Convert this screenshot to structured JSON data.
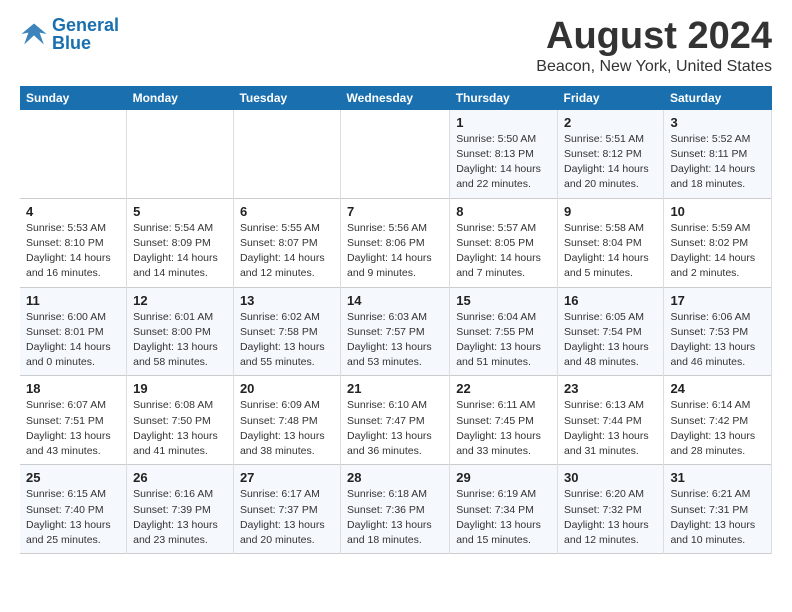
{
  "logo": {
    "text_general": "General",
    "text_blue": "Blue"
  },
  "title": "August 2024",
  "location": "Beacon, New York, United States",
  "days_of_week": [
    "Sunday",
    "Monday",
    "Tuesday",
    "Wednesday",
    "Thursday",
    "Friday",
    "Saturday"
  ],
  "weeks": [
    [
      {
        "num": "",
        "detail": ""
      },
      {
        "num": "",
        "detail": ""
      },
      {
        "num": "",
        "detail": ""
      },
      {
        "num": "",
        "detail": ""
      },
      {
        "num": "1",
        "detail": "Sunrise: 5:50 AM\nSunset: 8:13 PM\nDaylight: 14 hours\nand 22 minutes."
      },
      {
        "num": "2",
        "detail": "Sunrise: 5:51 AM\nSunset: 8:12 PM\nDaylight: 14 hours\nand 20 minutes."
      },
      {
        "num": "3",
        "detail": "Sunrise: 5:52 AM\nSunset: 8:11 PM\nDaylight: 14 hours\nand 18 minutes."
      }
    ],
    [
      {
        "num": "4",
        "detail": "Sunrise: 5:53 AM\nSunset: 8:10 PM\nDaylight: 14 hours\nand 16 minutes."
      },
      {
        "num": "5",
        "detail": "Sunrise: 5:54 AM\nSunset: 8:09 PM\nDaylight: 14 hours\nand 14 minutes."
      },
      {
        "num": "6",
        "detail": "Sunrise: 5:55 AM\nSunset: 8:07 PM\nDaylight: 14 hours\nand 12 minutes."
      },
      {
        "num": "7",
        "detail": "Sunrise: 5:56 AM\nSunset: 8:06 PM\nDaylight: 14 hours\nand 9 minutes."
      },
      {
        "num": "8",
        "detail": "Sunrise: 5:57 AM\nSunset: 8:05 PM\nDaylight: 14 hours\nand 7 minutes."
      },
      {
        "num": "9",
        "detail": "Sunrise: 5:58 AM\nSunset: 8:04 PM\nDaylight: 14 hours\nand 5 minutes."
      },
      {
        "num": "10",
        "detail": "Sunrise: 5:59 AM\nSunset: 8:02 PM\nDaylight: 14 hours\nand 2 minutes."
      }
    ],
    [
      {
        "num": "11",
        "detail": "Sunrise: 6:00 AM\nSunset: 8:01 PM\nDaylight: 14 hours\nand 0 minutes."
      },
      {
        "num": "12",
        "detail": "Sunrise: 6:01 AM\nSunset: 8:00 PM\nDaylight: 13 hours\nand 58 minutes."
      },
      {
        "num": "13",
        "detail": "Sunrise: 6:02 AM\nSunset: 7:58 PM\nDaylight: 13 hours\nand 55 minutes."
      },
      {
        "num": "14",
        "detail": "Sunrise: 6:03 AM\nSunset: 7:57 PM\nDaylight: 13 hours\nand 53 minutes."
      },
      {
        "num": "15",
        "detail": "Sunrise: 6:04 AM\nSunset: 7:55 PM\nDaylight: 13 hours\nand 51 minutes."
      },
      {
        "num": "16",
        "detail": "Sunrise: 6:05 AM\nSunset: 7:54 PM\nDaylight: 13 hours\nand 48 minutes."
      },
      {
        "num": "17",
        "detail": "Sunrise: 6:06 AM\nSunset: 7:53 PM\nDaylight: 13 hours\nand 46 minutes."
      }
    ],
    [
      {
        "num": "18",
        "detail": "Sunrise: 6:07 AM\nSunset: 7:51 PM\nDaylight: 13 hours\nand 43 minutes."
      },
      {
        "num": "19",
        "detail": "Sunrise: 6:08 AM\nSunset: 7:50 PM\nDaylight: 13 hours\nand 41 minutes."
      },
      {
        "num": "20",
        "detail": "Sunrise: 6:09 AM\nSunset: 7:48 PM\nDaylight: 13 hours\nand 38 minutes."
      },
      {
        "num": "21",
        "detail": "Sunrise: 6:10 AM\nSunset: 7:47 PM\nDaylight: 13 hours\nand 36 minutes."
      },
      {
        "num": "22",
        "detail": "Sunrise: 6:11 AM\nSunset: 7:45 PM\nDaylight: 13 hours\nand 33 minutes."
      },
      {
        "num": "23",
        "detail": "Sunrise: 6:13 AM\nSunset: 7:44 PM\nDaylight: 13 hours\nand 31 minutes."
      },
      {
        "num": "24",
        "detail": "Sunrise: 6:14 AM\nSunset: 7:42 PM\nDaylight: 13 hours\nand 28 minutes."
      }
    ],
    [
      {
        "num": "25",
        "detail": "Sunrise: 6:15 AM\nSunset: 7:40 PM\nDaylight: 13 hours\nand 25 minutes."
      },
      {
        "num": "26",
        "detail": "Sunrise: 6:16 AM\nSunset: 7:39 PM\nDaylight: 13 hours\nand 23 minutes."
      },
      {
        "num": "27",
        "detail": "Sunrise: 6:17 AM\nSunset: 7:37 PM\nDaylight: 13 hours\nand 20 minutes."
      },
      {
        "num": "28",
        "detail": "Sunrise: 6:18 AM\nSunset: 7:36 PM\nDaylight: 13 hours\nand 18 minutes."
      },
      {
        "num": "29",
        "detail": "Sunrise: 6:19 AM\nSunset: 7:34 PM\nDaylight: 13 hours\nand 15 minutes."
      },
      {
        "num": "30",
        "detail": "Sunrise: 6:20 AM\nSunset: 7:32 PM\nDaylight: 13 hours\nand 12 minutes."
      },
      {
        "num": "31",
        "detail": "Sunrise: 6:21 AM\nSunset: 7:31 PM\nDaylight: 13 hours\nand 10 minutes."
      }
    ]
  ]
}
